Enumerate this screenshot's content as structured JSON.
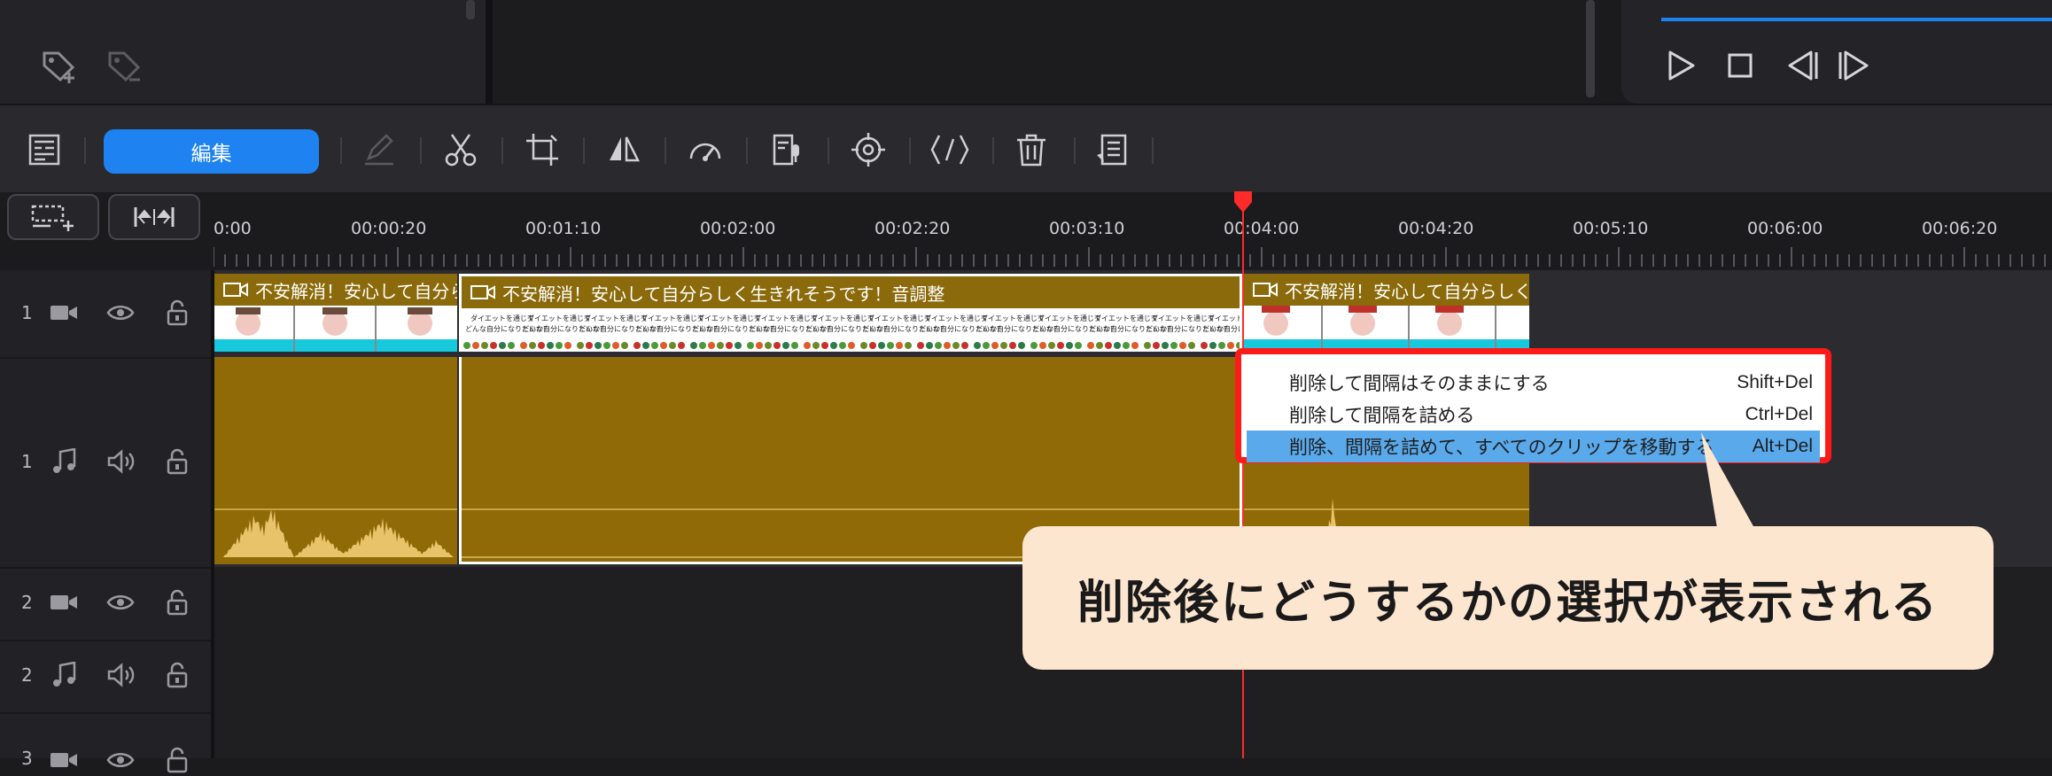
{
  "toolbar": {
    "edit_label": "編集",
    "icons": [
      "layout-icon",
      "edit-pen-icon",
      "scissors-icon",
      "crop-icon",
      "flip-icon",
      "speed-icon",
      "voiceover-icon",
      "target-icon",
      "transition-icon",
      "trash-icon",
      "text-icon"
    ]
  },
  "ruler": {
    "labels": [
      "0:00",
      "00:00:20",
      "00:01:10",
      "00:02:00",
      "00:02:20",
      "00:03:10",
      "00:04:00",
      "00:04:20",
      "00:05:10",
      "00:06:00",
      "00:06:20"
    ]
  },
  "tracks": [
    {
      "number": "1",
      "type": "video"
    },
    {
      "number": "1",
      "type": "audio"
    },
    {
      "number": "2",
      "type": "video"
    },
    {
      "number": "2",
      "type": "audio"
    },
    {
      "number": "3",
      "type": "video"
    }
  ],
  "clips": {
    "clip1_title": "不安解消！安心して自分ら",
    "clip2_title": "不安解消！安心して自分らしく生きれそうです！音調整",
    "clip3_title": "不安解消！安心して自分らしく生き",
    "thumb_caption_line1": "ダイエットを通じて",
    "thumb_caption_line2": "どんな自分になりたいか?"
  },
  "context_menu": {
    "items": [
      {
        "label": "削除して間隔はそのままにする",
        "shortcut": "Shift+Del"
      },
      {
        "label": "削除して間隔を詰める",
        "shortcut": "Ctrl+Del"
      },
      {
        "label": "削除、間隔を詰めて、すべてのクリップを移動する",
        "shortcut": "Alt+Del",
        "highlighted": true
      }
    ]
  },
  "callout": {
    "text": "削除後にどうするかの選択が表示される"
  },
  "colors": {
    "accent": "#1e82f0",
    "clip": "#8a6a0a",
    "highlight": "#5aa9ea",
    "menu_border": "#ff1a1a",
    "playhead": "#ff2a2a",
    "callout_bg": "#fde6cf"
  }
}
